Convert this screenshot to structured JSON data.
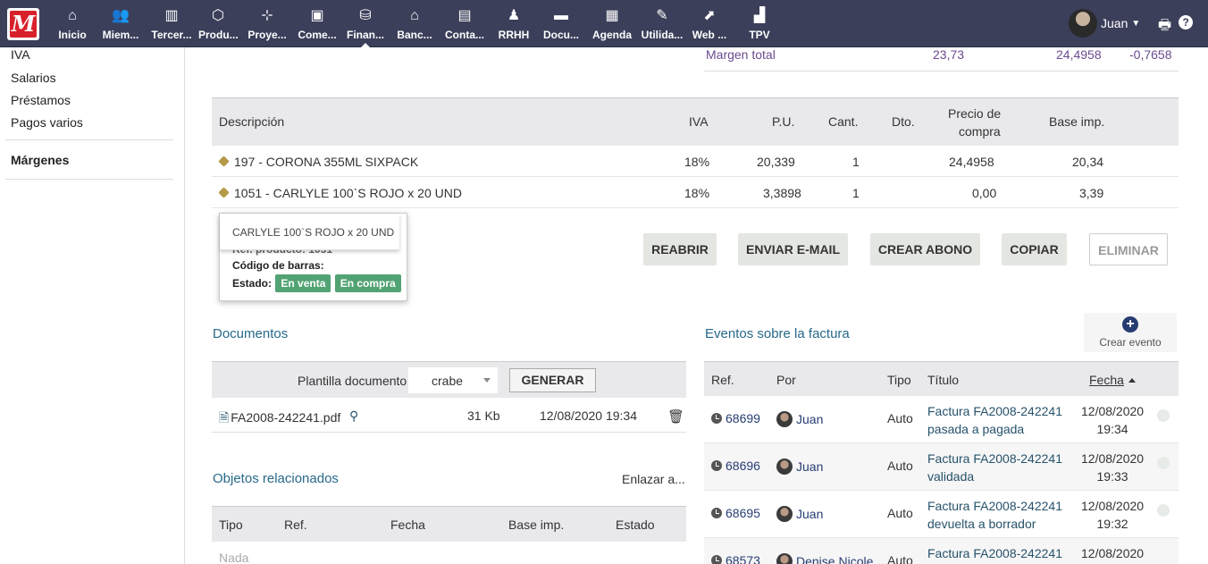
{
  "topbar": {
    "logo": "M",
    "menu": [
      {
        "icon": "⌂",
        "label": "Inicio"
      },
      {
        "icon": "👥",
        "label": "Miem..."
      },
      {
        "icon": "▥",
        "label": "Tercer..."
      },
      {
        "icon": "⬡",
        "label": "Produ..."
      },
      {
        "icon": "⊹",
        "label": "Proye..."
      },
      {
        "icon": "▣",
        "label": "Come..."
      },
      {
        "icon": "⛁",
        "label": "Finan..."
      },
      {
        "icon": "⌂",
        "label": "Banc..."
      },
      {
        "icon": "▤",
        "label": "Conta..."
      },
      {
        "icon": "♟",
        "label": "RRHH"
      },
      {
        "icon": "▬",
        "label": "Docu..."
      },
      {
        "icon": "▦",
        "label": "Agenda"
      },
      {
        "icon": "✎",
        "label": "Utilida..."
      },
      {
        "icon": "⬈",
        "label": "Web ..."
      },
      {
        "icon": "▟",
        "label": "TPV"
      }
    ],
    "user_name": "Juan",
    "print_icon": "🖶",
    "help_icon": "?"
  },
  "leftmenu": {
    "items": [
      "IVA",
      "Salarios",
      "Préstamos",
      "Pagos varios"
    ],
    "active": "Márgenes"
  },
  "margin": {
    "label": "Margen total",
    "v1": "23,73",
    "v2": "24,4958",
    "v3": "-0,7658"
  },
  "lines": {
    "headers": {
      "desc": "Descripción",
      "iva": "IVA",
      "pu": "P.U.",
      "qty": "Cant.",
      "dto": "Dto.",
      "buy1": "Precio de",
      "buy2": "compra",
      "base": "Base imp."
    },
    "rows": [
      {
        "desc": "197 - CORONA 355ML SIXPACK",
        "iva": "18%",
        "pu": "20,339",
        "qty": "1",
        "buy": "24,4958",
        "base": "20,34"
      },
      {
        "desc": "1051 - CARLYLE 100`S ROJO x 20 UND",
        "iva": "18%",
        "pu": "3,3898",
        "qty": "1",
        "buy": "0,00",
        "base": "3,39"
      }
    ]
  },
  "tooltip": {
    "title": "CARLYLE 100`S ROJO x 20 UND",
    "ref": "Ref. producto: 1051",
    "barcode": "Código de barras:",
    "status_label": "Estado:",
    "badge_sale": "En venta",
    "badge_buy": "En compra"
  },
  "actions": {
    "reopen": "REABRIR",
    "email": "ENVIAR E-MAIL",
    "credit": "CREAR ABONO",
    "copy": "COPIAR",
    "delete": "ELIMINAR"
  },
  "documents": {
    "title": "Documentos",
    "template_label": "Plantilla documento",
    "template_value": "crabe",
    "generate": "GENERAR",
    "file_name": "FA2008-242241.pdf",
    "file_size": "31 Kb",
    "file_date": "12/08/2020 19:34"
  },
  "related": {
    "title": "Objetos relacionados",
    "link": "Enlazar a...",
    "headers": {
      "tipo": "Tipo",
      "ref": "Ref.",
      "fecha": "Fecha",
      "base": "Base imp.",
      "estado": "Estado"
    },
    "empty": "Nada"
  },
  "events": {
    "title": "Eventos sobre la factura",
    "create": "Crear evento",
    "headers": {
      "ref": "Ref.",
      "por": "Por",
      "tipo": "Tipo",
      "titulo": "Título",
      "fecha": "Fecha"
    },
    "rows": [
      {
        "ref": "68699",
        "by": "Juan",
        "type": "Auto",
        "t1": "Factura FA2008-242241",
        "t2": "pasada a pagada",
        "d1": "12/08/2020",
        "d2": "19:34"
      },
      {
        "ref": "68696",
        "by": "Juan",
        "type": "Auto",
        "t1": "Factura FA2008-242241",
        "t2": "validada",
        "d1": "12/08/2020",
        "d2": "19:33"
      },
      {
        "ref": "68695",
        "by": "Juan",
        "type": "Auto",
        "t1": "Factura FA2008-242241",
        "t2": "devuelta a borrador",
        "d1": "12/08/2020",
        "d2": "19:32"
      },
      {
        "ref": "68573",
        "by": "Denise Nicole",
        "type": "Auto",
        "t1": "Factura FA2008-242241",
        "t2": "",
        "d1": "12/08/2020",
        "d2": ""
      }
    ]
  }
}
